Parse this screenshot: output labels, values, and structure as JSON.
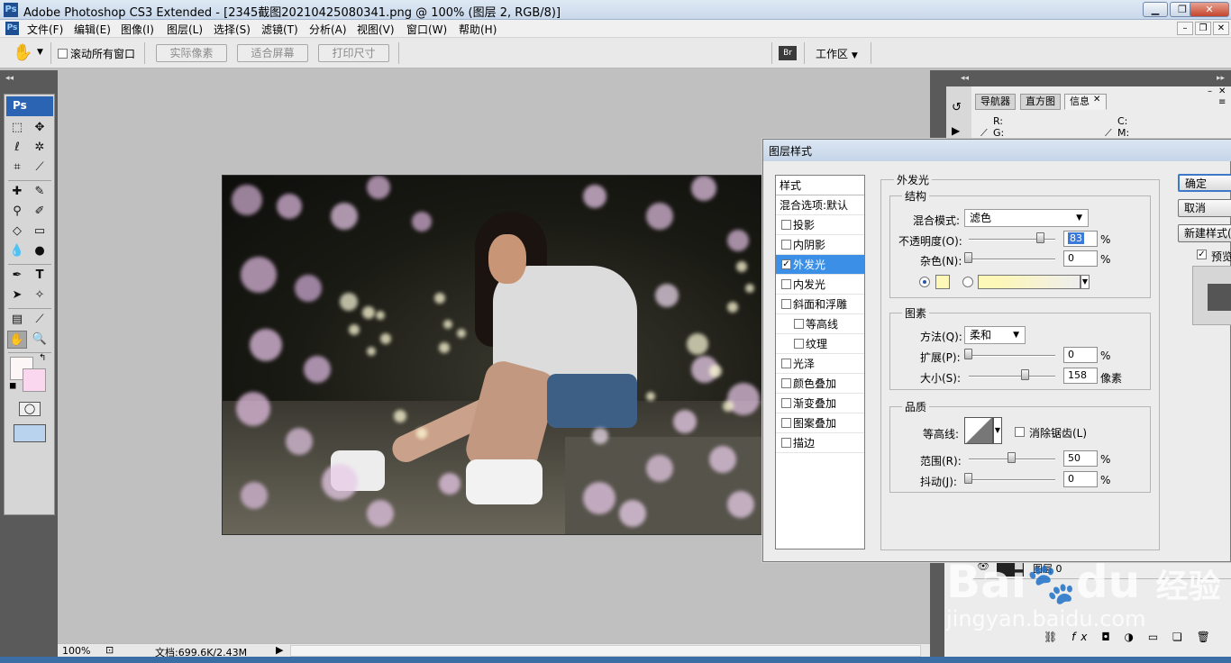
{
  "window": {
    "title": "Adobe Photoshop CS3 Extended - [2345截图20210425080341.png @ 100% (图层 2, RGB/8)]",
    "app_logo": "Ps"
  },
  "menu": {
    "items": [
      "文件(F)",
      "编辑(E)",
      "图像(I)",
      "图层(L)",
      "选择(S)",
      "滤镜(T)",
      "分析(A)",
      "视图(V)",
      "窗口(W)",
      "帮助(H)"
    ]
  },
  "options": {
    "scroll_all_label": "滚动所有窗口",
    "actual_pixels": "实际像素",
    "fit_screen": "适合屏幕",
    "print_size": "打印尺寸",
    "workspace": "工作区"
  },
  "tools": {
    "logo": "Ps"
  },
  "status": {
    "zoom": "100%",
    "doc_size": "文档:699.6K/2.43M"
  },
  "panels": {
    "tabs": [
      "导航器",
      "直方图",
      "信息"
    ],
    "active_tab": 2,
    "info_r": "R:",
    "info_g": "G:",
    "info_c": "C:",
    "info_m": "M:",
    "layer_name": "图层 0"
  },
  "dialog": {
    "title": "图层样式",
    "styles_header": "样式",
    "blending_options": "混合选项:默认",
    "effects": [
      {
        "label": "投影",
        "checked": false,
        "sub": false
      },
      {
        "label": "内阴影",
        "checked": false,
        "sub": false
      },
      {
        "label": "外发光",
        "checked": true,
        "sub": false,
        "selected": true
      },
      {
        "label": "内发光",
        "checked": false,
        "sub": false
      },
      {
        "label": "斜面和浮雕",
        "checked": false,
        "sub": false
      },
      {
        "label": "等高线",
        "checked": false,
        "sub": true
      },
      {
        "label": "纹理",
        "checked": false,
        "sub": true
      },
      {
        "label": "光泽",
        "checked": false,
        "sub": false
      },
      {
        "label": "颜色叠加",
        "checked": false,
        "sub": false
      },
      {
        "label": "渐变叠加",
        "checked": false,
        "sub": false
      },
      {
        "label": "图案叠加",
        "checked": false,
        "sub": false
      },
      {
        "label": "描边",
        "checked": false,
        "sub": false
      }
    ],
    "section_title": "外发光",
    "structure": {
      "title": "结构",
      "blend_mode_label": "混合模式:",
      "blend_mode": "滤色",
      "opacity_label": "不透明度(O):",
      "opacity": "83",
      "opacity_unit": "%",
      "noise_label": "杂色(N):",
      "noise": "0",
      "noise_unit": "%",
      "glow_color": "#fdf7b8"
    },
    "elements": {
      "title": "图素",
      "technique_label": "方法(Q):",
      "technique": "柔和",
      "spread_label": "扩展(P):",
      "spread": "0",
      "spread_unit": "%",
      "size_label": "大小(S):",
      "size": "158",
      "size_unit": "像素"
    },
    "quality": {
      "title": "品质",
      "contour_label": "等高线:",
      "antialias_label": "消除锯齿(L)",
      "range_label": "范围(R):",
      "range": "50",
      "range_unit": "%",
      "jitter_label": "抖动(J):",
      "jitter": "0",
      "jitter_unit": "%"
    },
    "buttons": {
      "ok": "确定",
      "cancel": "取消",
      "new_style": "新建样式(",
      "preview": "预览"
    }
  },
  "watermark": {
    "brand": "Bai",
    "brand2": "du",
    "cn": "经验",
    "url": "jingyan.baidu.com"
  }
}
